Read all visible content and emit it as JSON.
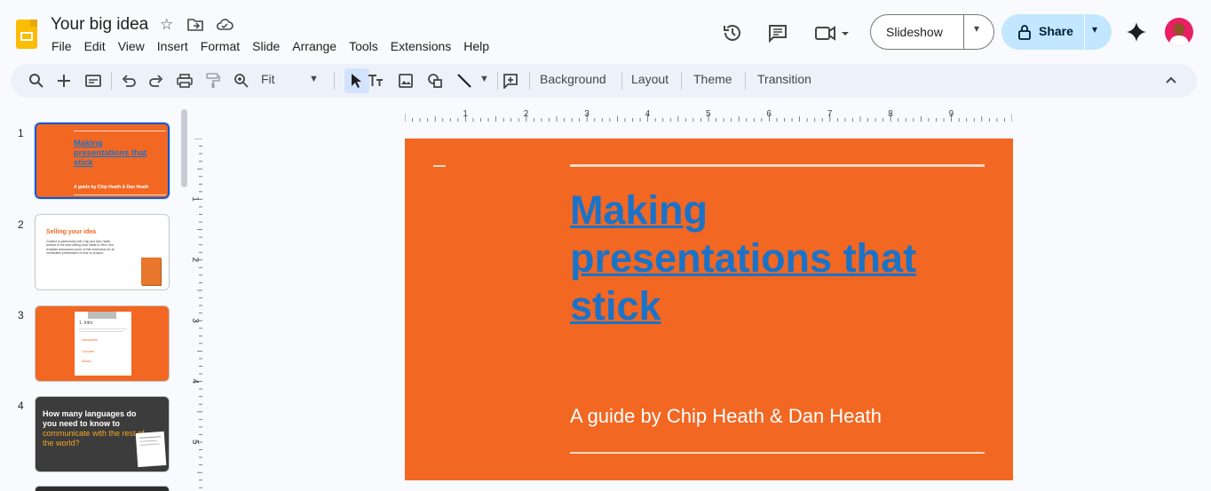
{
  "header": {
    "doc_title": "Your big idea",
    "menu": [
      "File",
      "Edit",
      "View",
      "Insert",
      "Format",
      "Slide",
      "Arrange",
      "Tools",
      "Extensions",
      "Help"
    ],
    "slideshow_label": "Slideshow",
    "share_label": "Share"
  },
  "toolbar": {
    "zoom_value": "Fit",
    "background_label": "Background",
    "layout_label": "Layout",
    "theme_label": "Theme",
    "transition_label": "Transition"
  },
  "filmstrip": {
    "slides": [
      {
        "number": "1",
        "title": "Making presentations that stick",
        "subtitle": "A guide by Chip Heath & Dan Heath"
      },
      {
        "number": "2",
        "title": "Selling your idea",
        "body": "Created in partnership with Chip and Dan Heath, authors of the best-selling book Made to Stick, this template showcases some of their best ideas for an memorable presentation of time or product."
      },
      {
        "number": "3",
        "title": "1. Intro",
        "items": [
          "Unexpected",
          "Concrete",
          "Stories"
        ]
      },
      {
        "number": "4",
        "title_a": "How many languages do you need to know to",
        "title_b": "communicate with the rest of the world?"
      }
    ]
  },
  "ruler": {
    "h_labels": [
      "1",
      "2",
      "3",
      "4",
      "5",
      "6",
      "7",
      "8",
      "9"
    ],
    "v_labels": [
      "1",
      "2",
      "3",
      "4",
      "5"
    ]
  },
  "slide": {
    "title": "Making presentations that stick",
    "subtitle": "A guide by Chip Heath & Dan Heath"
  },
  "colors": {
    "slide_background": "#f26722",
    "title_link": "#1a73c8",
    "accent_blue": "#0b57d0",
    "share_bg": "#c2e7ff",
    "slide4_bg": "#3c3c3c",
    "slide4_accent": "#f5a623"
  },
  "icons": {
    "header": [
      "slides-logo",
      "star-icon",
      "move-folder-icon",
      "cloud-status-icon",
      "version-history-icon",
      "comments-icon",
      "meet-icon",
      "lock-icon",
      "gemini-sparkle-icon",
      "avatar"
    ],
    "toolbar": [
      "search-icon",
      "plus-icon",
      "new-slide-icon",
      "undo-icon",
      "redo-icon",
      "print-icon",
      "paint-format-icon",
      "zoom-icon",
      "select-icon",
      "textbox-icon",
      "image-icon",
      "shape-icon",
      "line-icon",
      "comment-add-icon",
      "collapse-icon"
    ]
  }
}
